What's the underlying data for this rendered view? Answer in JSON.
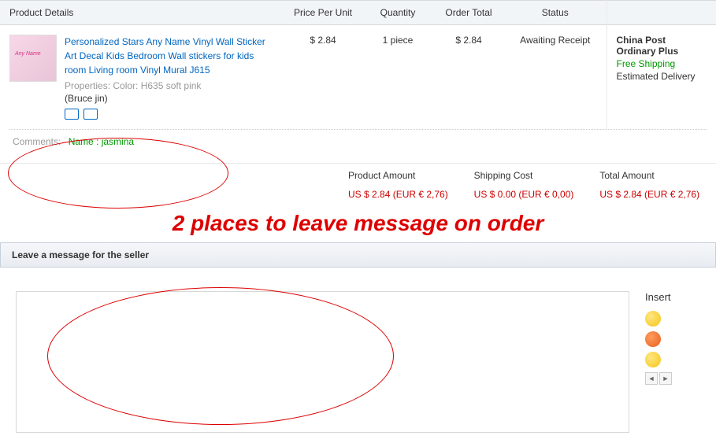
{
  "headers": {
    "product": "Product Details",
    "price": "Price Per Unit",
    "qty": "Quantity",
    "total": "Order Total",
    "status": "Status"
  },
  "item": {
    "title": "Personalized Stars Any Name Vinyl Wall Sticker Art Decal Kids Bedroom Wall stickers for kids room Living room Vinyl Mural J615",
    "properties": "Properties: Color: H635 soft pink",
    "seller": "(Bruce jin)",
    "price": "$ 2.84",
    "qty": "1 piece",
    "total": "$ 2.84",
    "status": "Awaiting Receipt"
  },
  "shipping": {
    "method": "China Post Ordinary Plus",
    "free": "Free Shipping",
    "estimated": "Estimated Delivery"
  },
  "comments": {
    "label": "Comments:",
    "value": "Name : jasmina"
  },
  "totals": {
    "product_label": "Product Amount",
    "product_value": "US $ 2.84 (EUR € 2,76)",
    "shipping_label": "Shipping Cost",
    "shipping_value": "US $ 0.00 (EUR € 0,00)",
    "total_label": "Total Amount",
    "total_value": "US $ 2.84 (EUR € 2,76)"
  },
  "annotation": "2 places to leave message on order",
  "message": {
    "header": "Leave a message for the seller",
    "placeholder": ""
  },
  "emoji": {
    "title": "Insert"
  }
}
